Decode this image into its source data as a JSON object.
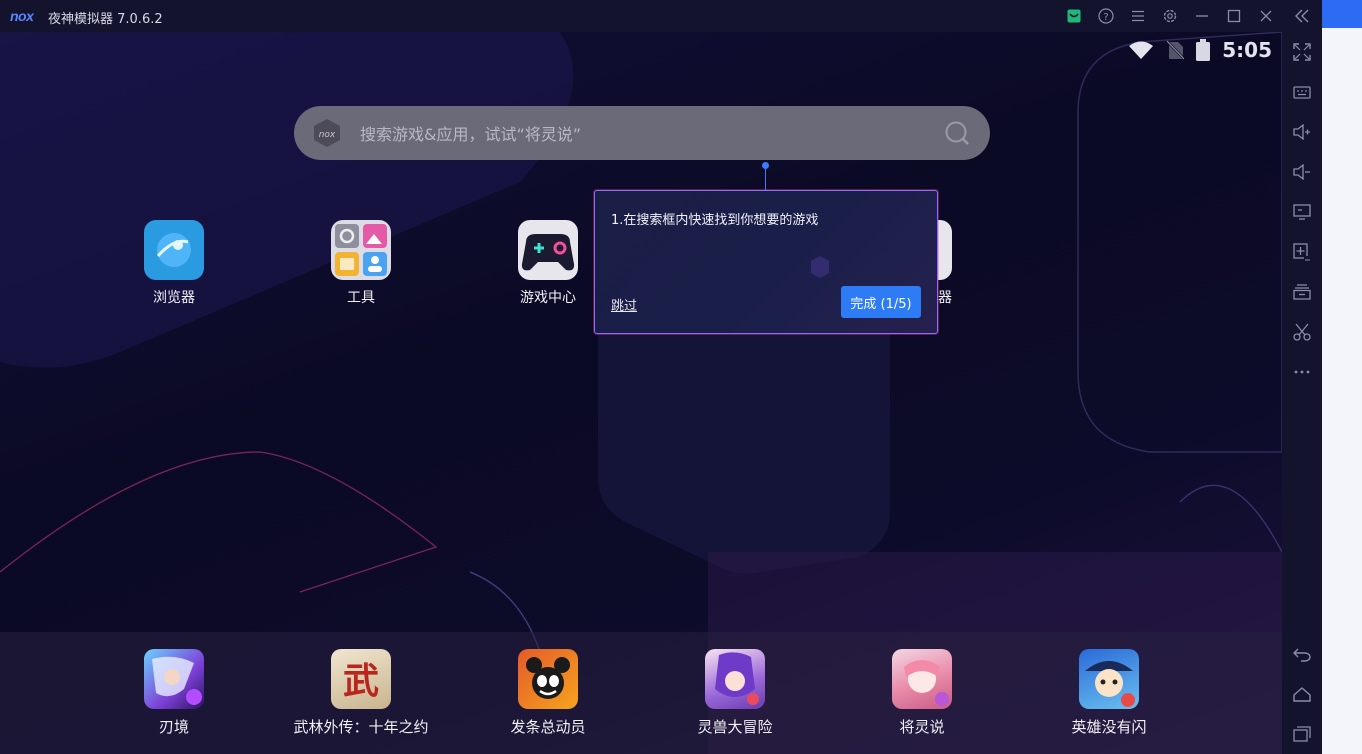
{
  "window": {
    "logo": "nox",
    "title": "夜神模拟器 7.0.6.2",
    "controls": [
      "store-icon",
      "help-icon",
      "menu-icon",
      "settings-icon",
      "minimize-icon",
      "maximize-icon",
      "close-icon",
      "collapse-icon"
    ]
  },
  "statusbar": {
    "clock": "5:05",
    "icons": [
      "wifi-icon",
      "no-sim-icon",
      "battery-icon"
    ]
  },
  "search": {
    "logo": "nox",
    "placeholder": "搜索游戏&应用，试试“将灵说”"
  },
  "home_apps": [
    {
      "label": "浏览器",
      "icon": "browser-icon"
    },
    {
      "label": "工具",
      "icon": "tools-icon"
    },
    {
      "label": "游戏中心",
      "icon": "game-center-icon"
    },
    {
      "label": "器",
      "icon": "partial-app-icon"
    }
  ],
  "guide": {
    "text": "1.在搜索框内快速找到你想要的游戏",
    "skip_label": "跳过",
    "done_label": "完成 (1/5)"
  },
  "dock_apps": [
    {
      "label": "刃境",
      "icon": "renjing-icon"
    },
    {
      "label": "武林外传：十年之约",
      "icon": "wulin-icon",
      "glyph": "武"
    },
    {
      "label": "发条总动员",
      "icon": "fatiao-icon"
    },
    {
      "label": "灵兽大冒险",
      "icon": "lingshou-icon"
    },
    {
      "label": "将灵说",
      "icon": "jiangling-icon"
    },
    {
      "label": "英雄没有闪",
      "icon": "yingxiong-icon"
    }
  ],
  "sidebar": {
    "top": [
      "fullscreen-icon",
      "keyboard-icon",
      "volume-up-icon",
      "volume-down-icon",
      "screen-icon",
      "add-apk-icon",
      "multi-instance-icon",
      "scissors-icon",
      "more-icon"
    ],
    "bottom": [
      "back-icon",
      "home-icon",
      "recent-apps-icon"
    ]
  },
  "colors": {
    "accent": "#2d7cf6",
    "titlebar": "#13132d",
    "dock": "#282040"
  }
}
